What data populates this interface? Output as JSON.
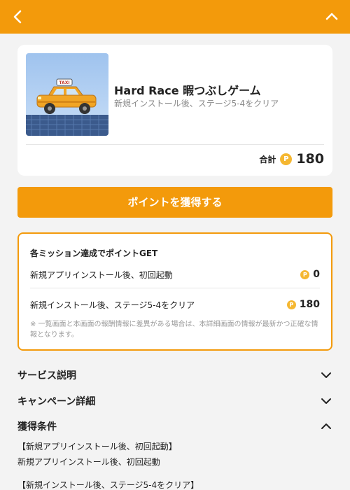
{
  "header": {
    "back_icon": "chevron-left-icon",
    "collapse_icon": "chevron-up-icon",
    "background": "#f39a0b"
  },
  "app": {
    "title": "Hard Race 暇つぶしゲーム",
    "subtitle": "新規インストール後、ステージ5‐4をクリア",
    "total_label": "合計",
    "total_points": "180",
    "thumbnail_sign": "TAXI"
  },
  "cta": {
    "label": "ポイントを獲得する"
  },
  "missions": {
    "title": "各ミッション達成でポイントGET",
    "items": [
      {
        "label": "新規アプリインストール後、初回起動",
        "points": "0"
      },
      {
        "label": "新規インストール後、ステージ5‐4をクリア",
        "points": "180"
      }
    ],
    "note": "※ 一覧画面と本画面の報酬情報に差異がある場合は、本詳細画面の情報が最新かつ正確な情報となります。"
  },
  "sections": {
    "service": "サービス説明",
    "campaign": "キャンペーン詳細",
    "conditions": "獲得条件"
  },
  "conditions": {
    "heading1": "【新規アプリインストール後、初回起動】",
    "text1": "新規アプリインストール後、初回起動",
    "heading2": "【新規インストール後、ステージ5‐4をクリア】"
  },
  "colors": {
    "accent": "#f39a0b",
    "coin": "#f5b731",
    "background": "#f3f3f3"
  }
}
